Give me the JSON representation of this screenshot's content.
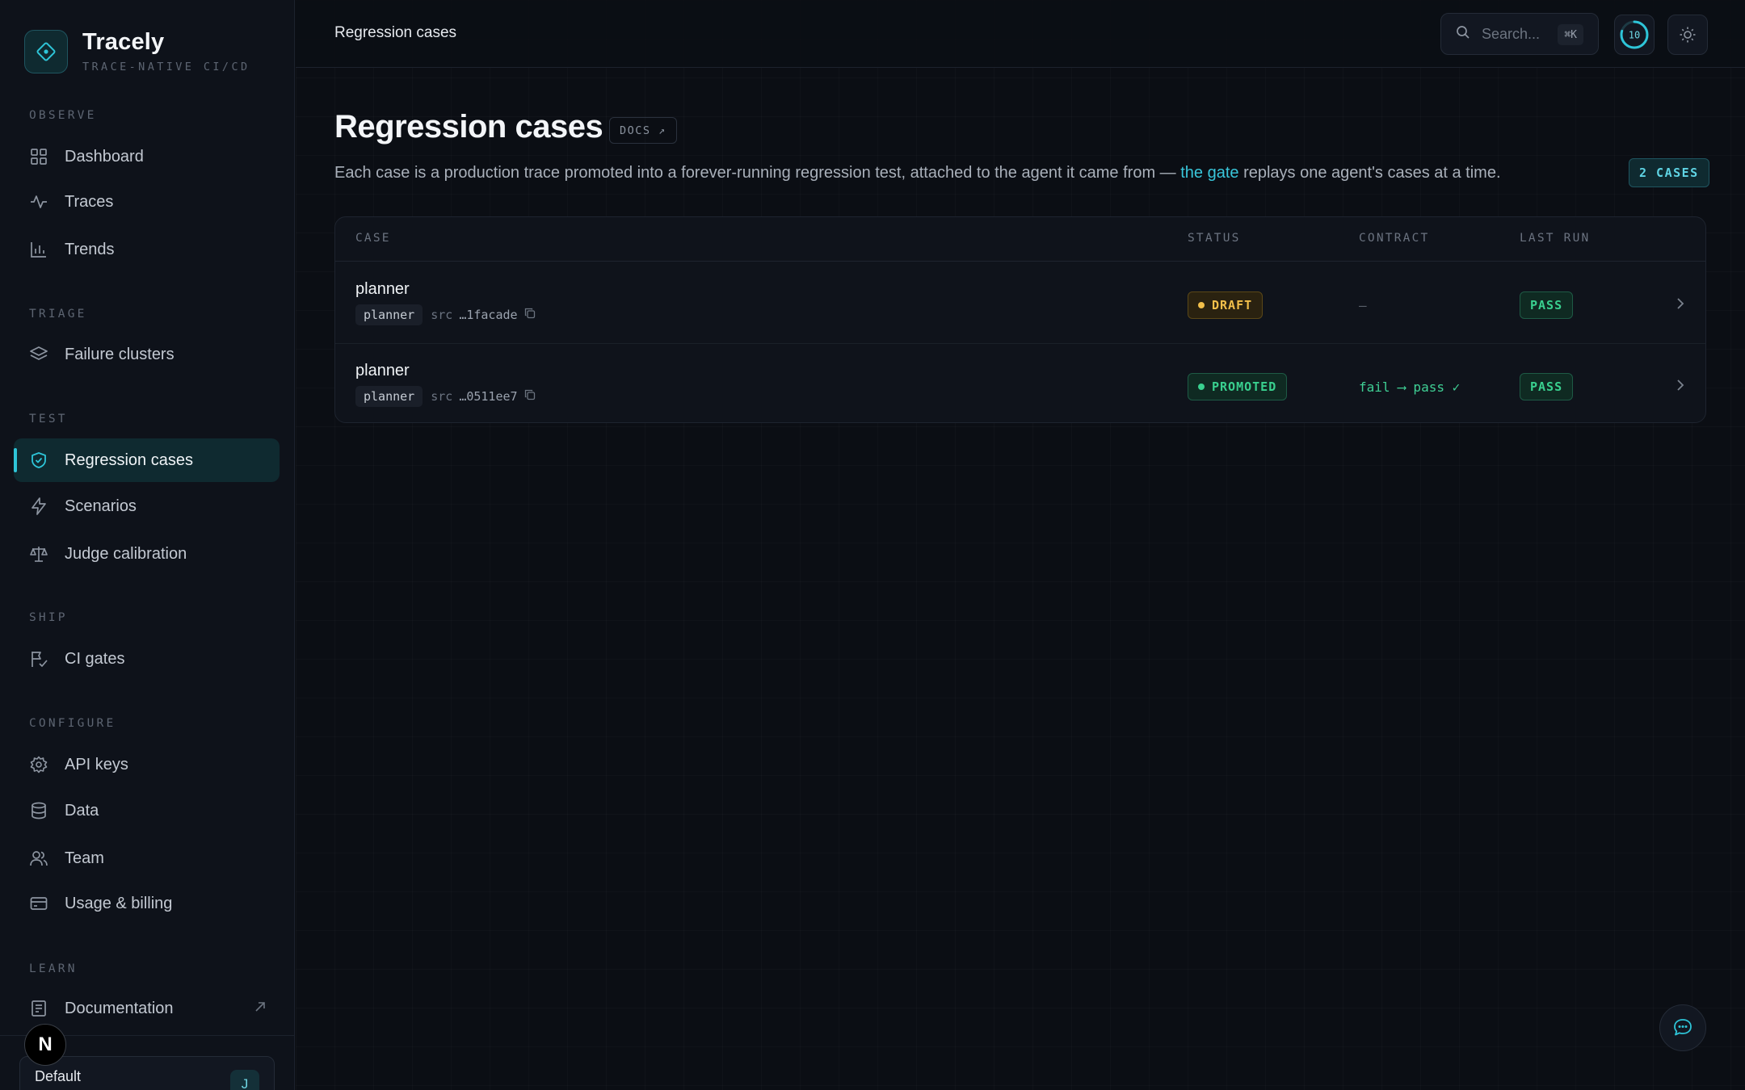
{
  "brand": {
    "name": "Tracely",
    "tagline": "TRACE-NATIVE CI/CD"
  },
  "sidebar": {
    "sections": [
      {
        "title": "OBSERVE",
        "items": [
          {
            "label": "Dashboard",
            "icon": "grid-icon"
          },
          {
            "label": "Traces",
            "icon": "activity-icon"
          },
          {
            "label": "Trends",
            "icon": "bar-chart-icon"
          }
        ]
      },
      {
        "title": "TRIAGE",
        "items": [
          {
            "label": "Failure clusters",
            "icon": "layers-icon"
          }
        ]
      },
      {
        "title": "TEST",
        "items": [
          {
            "label": "Regression cases",
            "icon": "shield-check-icon",
            "active": true
          },
          {
            "label": "Scenarios",
            "icon": "zap-icon"
          },
          {
            "label": "Judge calibration",
            "icon": "scale-icon"
          }
        ]
      },
      {
        "title": "SHIP",
        "items": [
          {
            "label": "CI gates",
            "icon": "flag-check-icon"
          }
        ]
      },
      {
        "title": "CONFIGURE",
        "items": [
          {
            "label": "API keys",
            "icon": "gear-icon"
          },
          {
            "label": "Data",
            "icon": "database-icon"
          },
          {
            "label": "Team",
            "icon": "users-icon"
          },
          {
            "label": "Usage & billing",
            "icon": "credit-card-icon"
          }
        ]
      },
      {
        "title": "LEARN",
        "items": [
          {
            "label": "Documentation",
            "icon": "book-icon",
            "external": true
          }
        ]
      }
    ],
    "workspace": {
      "name": "Default",
      "avatar": "J"
    },
    "overlay_badge": "N"
  },
  "topbar": {
    "breadcrumb": "Regression cases",
    "search_placeholder": "Search...",
    "search_shortcut": "⌘K",
    "progress_value": "10"
  },
  "page": {
    "title": "Regression cases",
    "docs_label": "DOCS ↗",
    "subtitle_before": "Each case is a production trace promoted into a forever-running regression test, attached to the agent it came from — ",
    "subtitle_link": "the gate",
    "subtitle_after": " replays one agent's cases at a time.",
    "count_badge": "2 CASES"
  },
  "table": {
    "columns": [
      "CASE",
      "STATUS",
      "CONTRACT",
      "LAST RUN"
    ],
    "rows": [
      {
        "name": "planner",
        "agent": "planner",
        "src_label": "src",
        "hash": "…1facade",
        "status": "DRAFT",
        "contract": "—",
        "last_run": "PASS"
      },
      {
        "name": "planner",
        "agent": "planner",
        "src_label": "src",
        "hash": "…0511ee7",
        "status": "PROMOTED",
        "contract": "fail ⟶ pass ✓",
        "last_run": "PASS"
      }
    ]
  },
  "colors": {
    "accent": "#2ec5d8",
    "draft": "#f2bf4a",
    "promoted": "#39d08f",
    "background": "#0b0e14"
  }
}
